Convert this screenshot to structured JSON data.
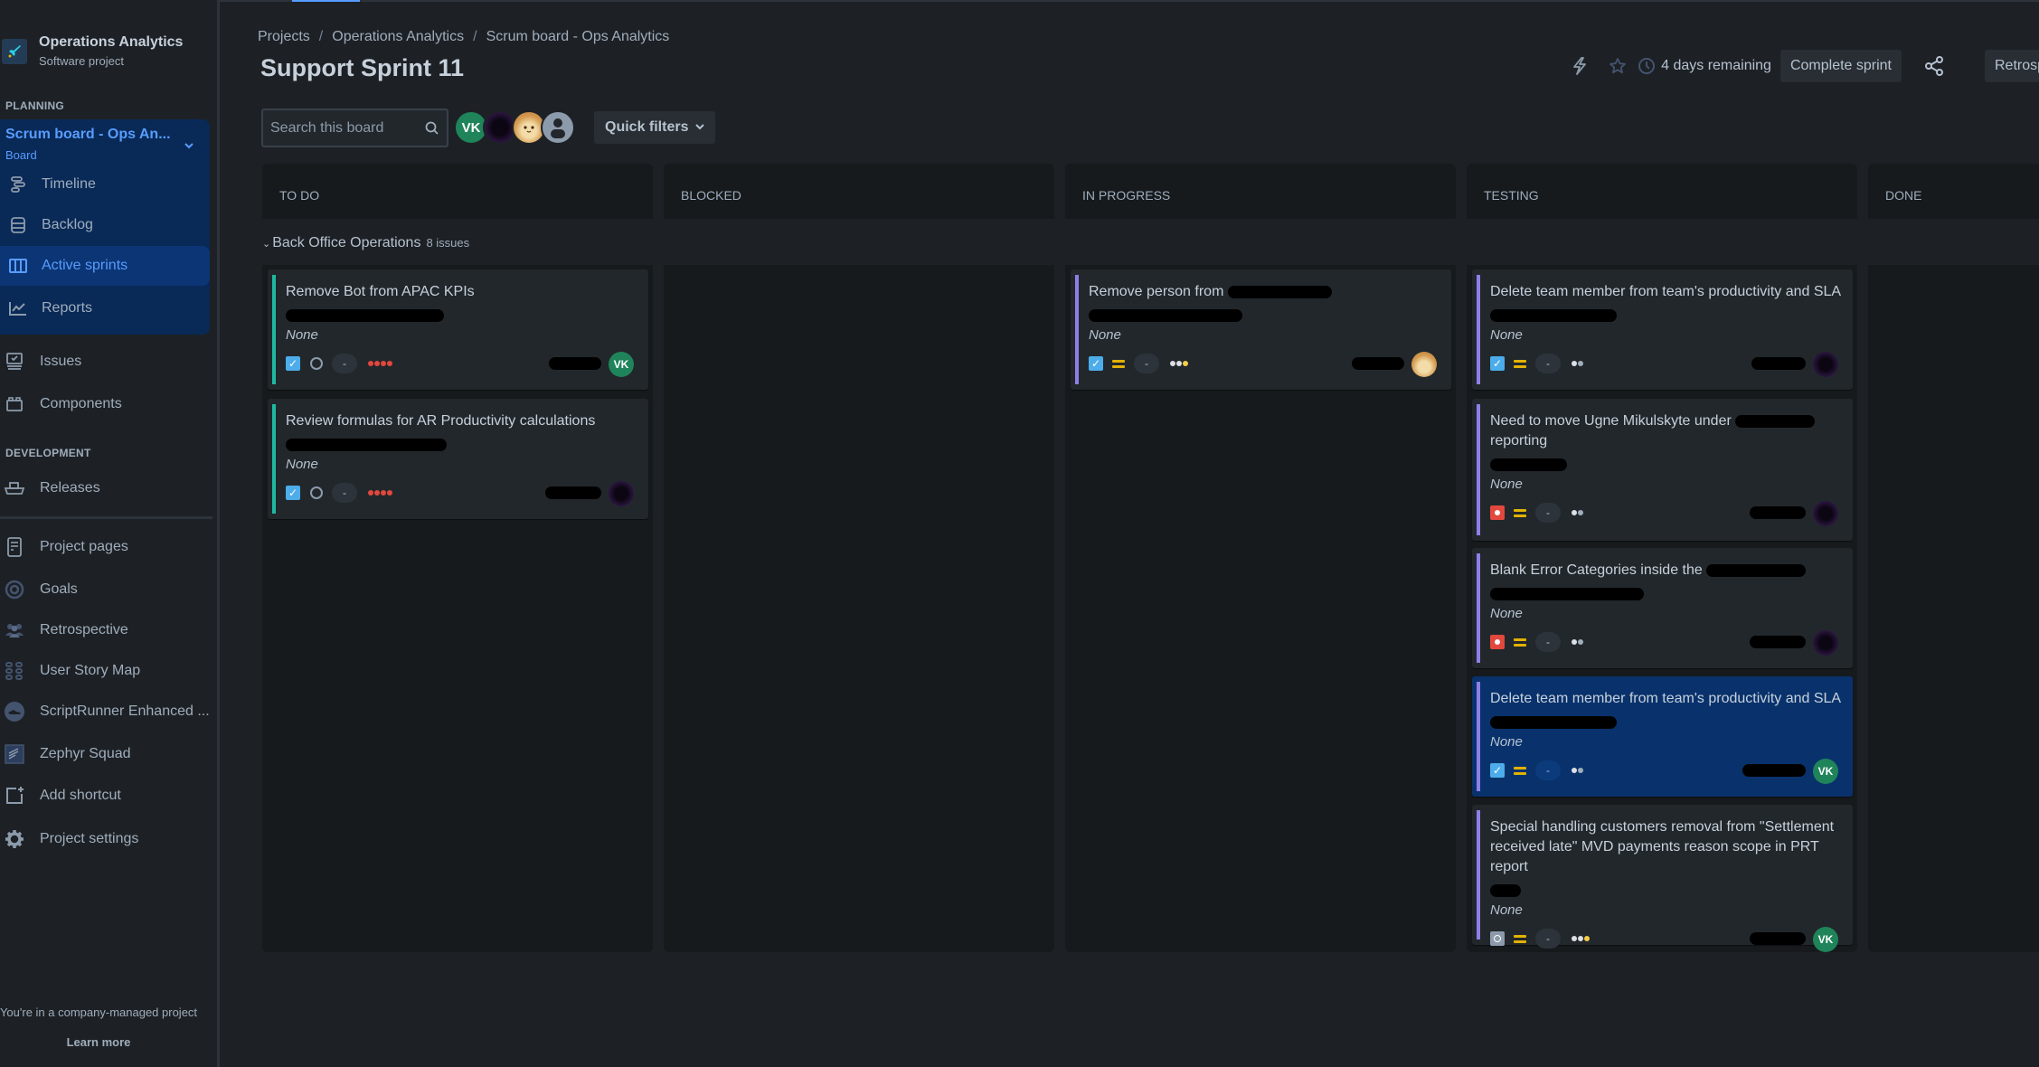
{
  "sidebar": {
    "project_name": "Operations Analytics",
    "project_type": "Software project",
    "planning_label": "PLANNING",
    "board_title": "Scrum board - Ops An...",
    "board_sub": "Board",
    "planning_items": [
      {
        "label": "Timeline",
        "icon": "timeline-icon"
      },
      {
        "label": "Backlog",
        "icon": "backlog-icon"
      },
      {
        "label": "Active sprints",
        "icon": "board-columns-icon",
        "active": true
      },
      {
        "label": "Reports",
        "icon": "reports-icon"
      }
    ],
    "issues_label": "Issues",
    "components_label": "Components",
    "development_label": "DEVELOPMENT",
    "releases_label": "Releases",
    "extra_items": [
      {
        "label": "Project pages",
        "icon": "page-icon"
      },
      {
        "label": "Goals",
        "icon": "goals-icon"
      },
      {
        "label": "Retrospective",
        "icon": "team-icon"
      },
      {
        "label": "User Story Map",
        "icon": "story-map-icon"
      },
      {
        "label": "ScriptRunner Enhanced ...",
        "icon": "scriptrunner-icon"
      },
      {
        "label": "Zephyr Squad",
        "icon": "zephyr-icon"
      },
      {
        "label": "Add shortcut",
        "icon": "add-shortcut-icon"
      },
      {
        "label": "Project settings",
        "icon": "gear-icon"
      }
    ],
    "footer_text": "You're in a company-managed project",
    "learn_more": "Learn more"
  },
  "header": {
    "breadcrumbs": [
      "Projects",
      "Operations Analytics",
      "Scrum board - Ops Analytics"
    ],
    "title": "Support Sprint 11",
    "remaining": "4 days remaining",
    "complete_sprint": "Complete sprint",
    "retro_button": "Retrospective"
  },
  "toolbar": {
    "search_placeholder": "Search this board",
    "avatars": [
      {
        "initials": "VK",
        "name": "VK"
      },
      {
        "initials": "",
        "name": "dark-avatar"
      },
      {
        "initials": "",
        "name": "fox-avatar"
      },
      {
        "initials": "",
        "name": "default-user"
      }
    ],
    "quick_filters": "Quick filters"
  },
  "board": {
    "columns": [
      "TO DO",
      "BLOCKED",
      "IN PROGRESS",
      "TESTING",
      "DONE"
    ],
    "swimlane": {
      "name": "Back Office Operations",
      "count": "8 issues"
    },
    "cards": {
      "todo": [
        {
          "title": "Remove Bot from APAC KPIs",
          "fix_version": "None",
          "type": "story",
          "priority": "lowest",
          "estimate": "-",
          "dots": [
            "red",
            "red",
            "red",
            "red"
          ],
          "assignee": "VK"
        },
        {
          "title": "Review formulas for AR Productivity calculations",
          "fix_version": "None",
          "type": "story",
          "priority": "lowest",
          "estimate": "-",
          "dots": [
            "red",
            "red",
            "red",
            "red"
          ],
          "assignee": "dark"
        }
      ],
      "in_progress": [
        {
          "title": "Remove person from",
          "fix_version": "None",
          "type": "story",
          "priority": "medium",
          "estimate": "-",
          "dots": [
            "white",
            "white",
            "gold"
          ],
          "assignee": "fox"
        }
      ],
      "testing": [
        {
          "title": "Delete team member from team's productivity and SLA",
          "fix_version": "None",
          "type": "story",
          "priority": "medium",
          "estimate": "-",
          "dots": [
            "white",
            "white"
          ],
          "assignee": "dark"
        },
        {
          "title": "Need to move Ugne Mikulskyte under",
          "title_line2": "reporting",
          "fix_version": "None",
          "type": "bug",
          "priority": "medium",
          "estimate": "-",
          "dots": [
            "white",
            "white"
          ],
          "assignee": "dark"
        },
        {
          "title": "Blank Error Categories inside the",
          "fix_version": "None",
          "type": "bug",
          "priority": "medium",
          "estimate": "-",
          "dots": [
            "white",
            "white"
          ],
          "assignee": "dark"
        },
        {
          "title": "Delete team member from team's productivity and SLA",
          "fix_version": "None",
          "type": "story",
          "priority": "medium",
          "estimate": "-",
          "dots": [
            "white",
            "white"
          ],
          "assignee": "VK",
          "selected": true
        },
        {
          "title": "Special handling customers removal from \"Settlement received late\" MVD payments reason scope in PRT report",
          "fix_version": "None",
          "type": "task",
          "priority": "medium",
          "estimate": "-",
          "dots": [
            "white",
            "white",
            "gold"
          ],
          "assignee": "VK"
        }
      ]
    }
  },
  "colors": {
    "accent": "#579dff",
    "todo_bar": "#1fb9a2",
    "progress_bar": "#8f7ee7",
    "selected_card": "#09326c",
    "avatar_vk": "#1f845a"
  }
}
